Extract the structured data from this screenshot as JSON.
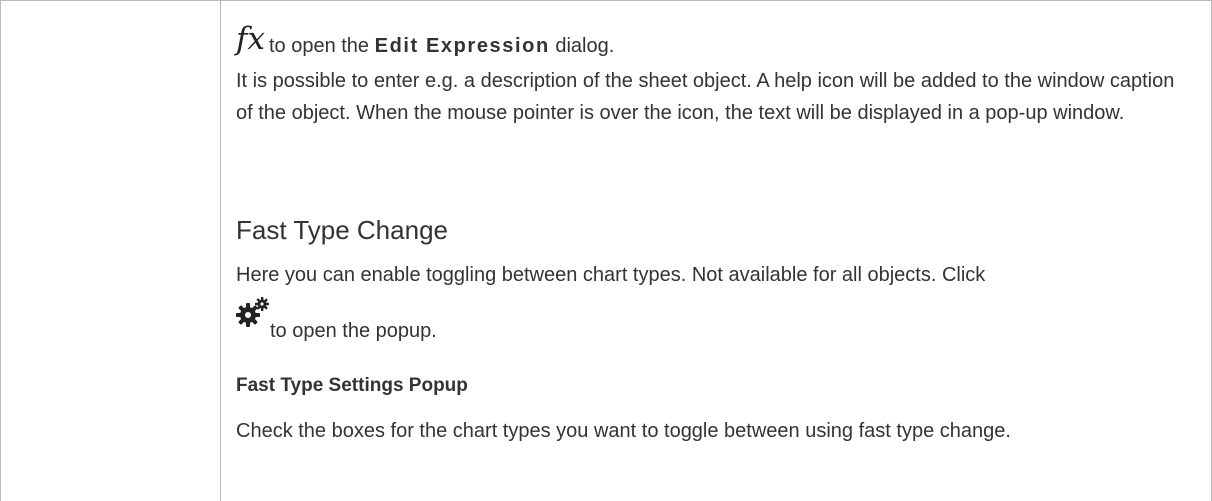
{
  "fx_line": {
    "icon_glyph": "fx",
    "prefix": "to open the ",
    "bold": "Edit Expression",
    "suffix": " dialog."
  },
  "description": "It is possible to enter e.g. a description of the sheet object. A help icon will be added to the window caption of the object. When the mouse pointer is over the icon, the text will be displayed in a pop-up window.",
  "heading": "Fast Type Change",
  "enable_text": "Here you can enable toggling between chart types. Not available for all objects. Click",
  "gear_line": {
    "icon": "gears-icon",
    "text": "to open the popup."
  },
  "subheading": "Fast Type Settings Popup",
  "check_text": "Check the boxes for the chart types you want to toggle between using fast type change.",
  "colors": {
    "text": "#333333",
    "border": "#b9b9b9",
    "icon": "#222222"
  }
}
